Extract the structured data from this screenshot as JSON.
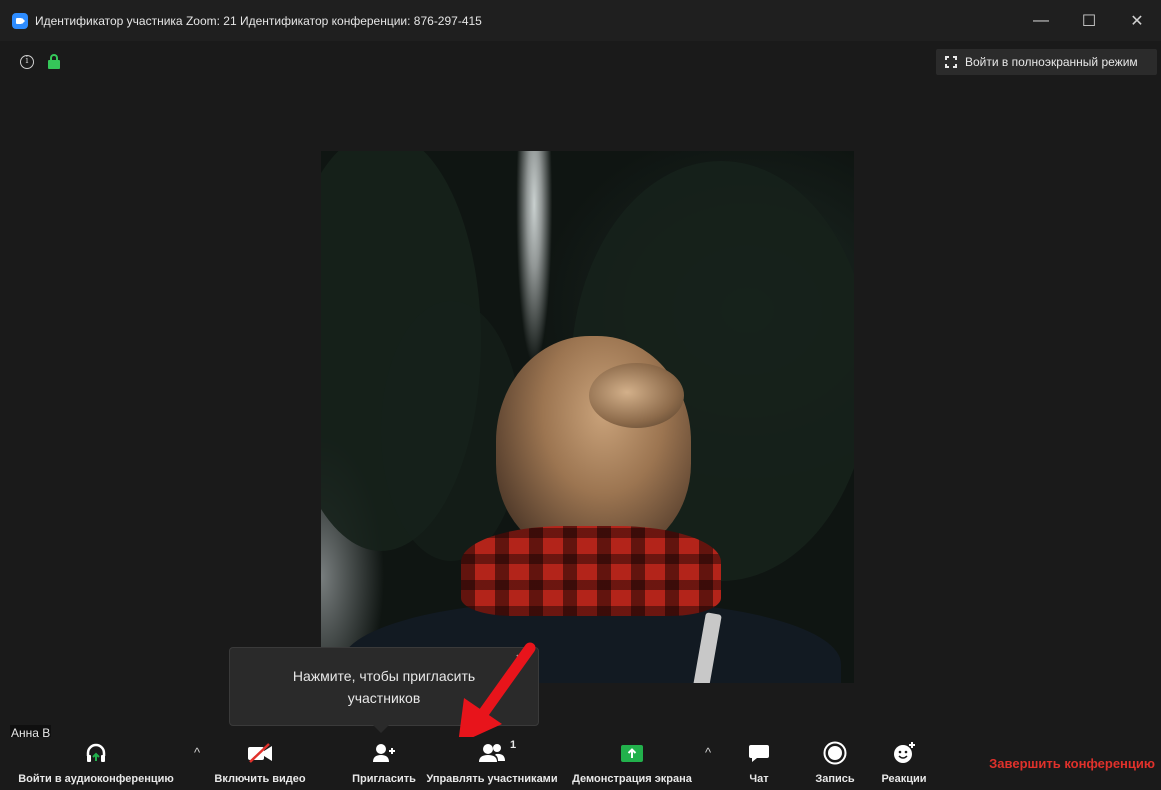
{
  "window": {
    "title": "Идентификатор участника Zoom: 21  Идентификатор конференции: 876-297-415",
    "minimize": "—",
    "maximize": "☐",
    "close": "✕"
  },
  "meeting": {
    "fullscreen_label": "Войти в полноэкранный режим",
    "info_glyph": "i",
    "participant_name": "Анна В"
  },
  "tooltip": {
    "text": "Нажмите, чтобы пригласить участников",
    "close_glyph": "✕"
  },
  "toolbar": {
    "audio_label": "Войти в аудиоконференцию",
    "video_label": "Включить видео",
    "invite_label": "Пригласить",
    "participants_label": "Управлять участниками",
    "participants_count": "1",
    "share_label": "Демонстрация экрана",
    "chat_label": "Чат",
    "record_label": "Запись",
    "reactions_label": "Реакции",
    "end_label": "Завершить конференцию",
    "caret_glyph": "^"
  },
  "colors": {
    "accent_blue": "#2d8cff",
    "share_green": "#22b14c",
    "end_red": "#e0312b",
    "arrow_red": "#e8141b",
    "lock_green": "#35c759"
  }
}
